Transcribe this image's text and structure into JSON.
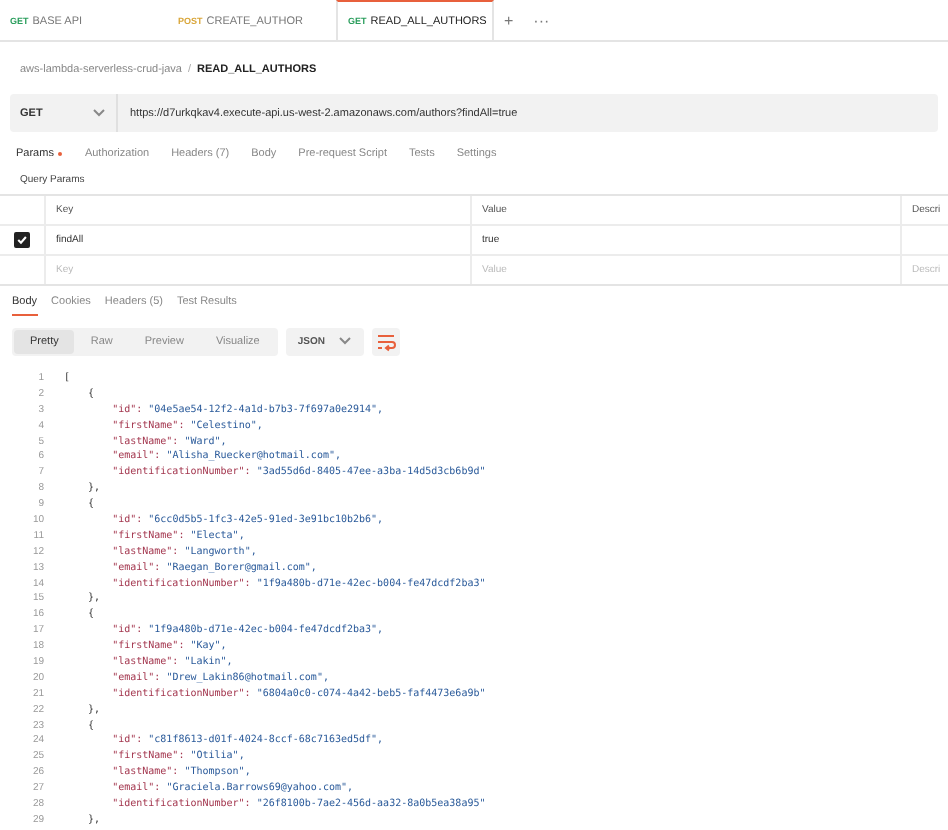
{
  "tabs": [
    {
      "method": "GET",
      "label": "BASE API",
      "selected": false
    },
    {
      "method": "POST",
      "label": "CREATE_AUTHOR",
      "selected": false
    },
    {
      "method": "GET",
      "label": "READ_ALL_AUTHORS",
      "selected": true
    }
  ],
  "tab_actions": [
    "+",
    "···"
  ],
  "breadcrumb": {
    "collection": "aws-lambda-serverless-crud-java",
    "separator": "/",
    "request": "READ_ALL_AUTHORS"
  },
  "request": {
    "method": "GET",
    "url": "https://d7urkqkav4.execute-api.us-west-2.amazonaws.com/authors?findAll=true"
  },
  "request_tabs": [
    {
      "label": "Params",
      "selected": true,
      "dot": true
    },
    {
      "label": "Authorization",
      "selected": false,
      "dot": false
    },
    {
      "label": "Headers (7)",
      "selected": false,
      "dot": false
    },
    {
      "label": "Body",
      "selected": false,
      "dot": false
    },
    {
      "label": "Pre-request Script",
      "selected": false,
      "dot": false
    },
    {
      "label": "Tests",
      "selected": false,
      "dot": false
    },
    {
      "label": "Settings",
      "selected": false,
      "dot": false
    }
  ],
  "query_params": {
    "title": "Query Params",
    "columns": [
      "Key",
      "Value",
      "Descri"
    ],
    "rows": [
      {
        "checked": true,
        "key": "findAll",
        "value": "true"
      }
    ],
    "new_row": {
      "key": {
        "placeholder": "Key"
      },
      "value": {
        "placeholder": "Value"
      },
      "description": {
        "placeholder": "Descri"
      }
    }
  },
  "response_tabs": [
    {
      "label": "Body",
      "selected": true
    },
    {
      "label": "Cookies",
      "selected": false
    },
    {
      "label": "Headers (5)",
      "selected": false
    },
    {
      "label": "Test Results",
      "selected": false
    }
  ],
  "view_modes": [
    {
      "label": "Pretty",
      "selected": true
    },
    {
      "label": "Raw",
      "selected": false
    },
    {
      "label": "Preview",
      "selected": false
    },
    {
      "label": "Visualize",
      "selected": false
    }
  ],
  "format": "JSON",
  "code_lines": [
    {
      "number": "1",
      "kind": "punct",
      "text": "["
    },
    {
      "number": "2",
      "kind": "punct",
      "text": "    {"
    },
    {
      "number": "3",
      "kind": "pair",
      "key": "        \"id\":",
      "value": "\"04e5ae54-12f2-4a1d-b7b3-7f697a0e2914\","
    },
    {
      "number": "4",
      "kind": "pair",
      "key": "        \"firstName\":",
      "value": "\"Celestino\","
    },
    {
      "number": "5",
      "kind": "pair",
      "key": "        \"lastName\":",
      "value": "\"Ward\","
    },
    {
      "number": "6",
      "kind": "pair",
      "key": "        \"email\":",
      "value": "\"Alisha_Ruecker@hotmail.com\","
    },
    {
      "number": "7",
      "kind": "pair",
      "key": "        \"identificationNumber\":",
      "value": "\"3ad55d6d-8405-47ee-a3ba-14d5d3cb6b9d\""
    },
    {
      "number": "8",
      "kind": "punct",
      "text": "    },"
    },
    {
      "number": "9",
      "kind": "punct",
      "text": "    {"
    },
    {
      "number": "10",
      "kind": "pair",
      "key": "        \"id\":",
      "value": "\"6cc0d5b5-1fc3-42e5-91ed-3e91bc10b2b6\","
    },
    {
      "number": "11",
      "kind": "pair",
      "key": "        \"firstName\":",
      "value": "\"Electa\","
    },
    {
      "number": "12",
      "kind": "pair",
      "key": "        \"lastName\":",
      "value": "\"Langworth\","
    },
    {
      "number": "13",
      "kind": "pair",
      "key": "        \"email\":",
      "value": "\"Raegan_Borer@gmail.com\","
    },
    {
      "number": "14",
      "kind": "pair",
      "key": "        \"identificationNumber\":",
      "value": "\"1f9a480b-d71e-42ec-b004-fe47dcdf2ba3\""
    },
    {
      "number": "15",
      "kind": "punct",
      "text": "    },"
    },
    {
      "number": "16",
      "kind": "punct",
      "text": "    {"
    },
    {
      "number": "17",
      "kind": "pair",
      "key": "        \"id\":",
      "value": "\"1f9a480b-d71e-42ec-b004-fe47dcdf2ba3\","
    },
    {
      "number": "18",
      "kind": "pair",
      "key": "        \"firstName\":",
      "value": "\"Kay\","
    },
    {
      "number": "19",
      "kind": "pair",
      "key": "        \"lastName\":",
      "value": "\"Lakin\","
    },
    {
      "number": "20",
      "kind": "pair",
      "key": "        \"email\":",
      "value": "\"Drew_Lakin86@hotmail.com\","
    },
    {
      "number": "21",
      "kind": "pair",
      "key": "        \"identificationNumber\":",
      "value": "\"6804a0c0-c074-4a42-beb5-faf4473e6a9b\""
    },
    {
      "number": "22",
      "kind": "punct",
      "text": "    },"
    },
    {
      "number": "23",
      "kind": "punct",
      "text": "    {"
    },
    {
      "number": "24",
      "kind": "pair",
      "key": "        \"id\":",
      "value": "\"c81f8613-d01f-4024-8ccf-68c7163ed5df\","
    },
    {
      "number": "25",
      "kind": "pair",
      "key": "        \"firstName\":",
      "value": "\"Otilia\","
    },
    {
      "number": "26",
      "kind": "pair",
      "key": "        \"lastName\":",
      "value": "\"Thompson\","
    },
    {
      "number": "27",
      "kind": "pair",
      "key": "        \"email\":",
      "value": "\"Graciela.Barrows69@yahoo.com\","
    },
    {
      "number": "28",
      "kind": "pair",
      "key": "        \"identificationNumber\":",
      "value": "\"26f8100b-7ae2-456d-aa32-8a0b5ea38a95\""
    },
    {
      "number": "29",
      "kind": "punct",
      "text": "    },"
    }
  ]
}
